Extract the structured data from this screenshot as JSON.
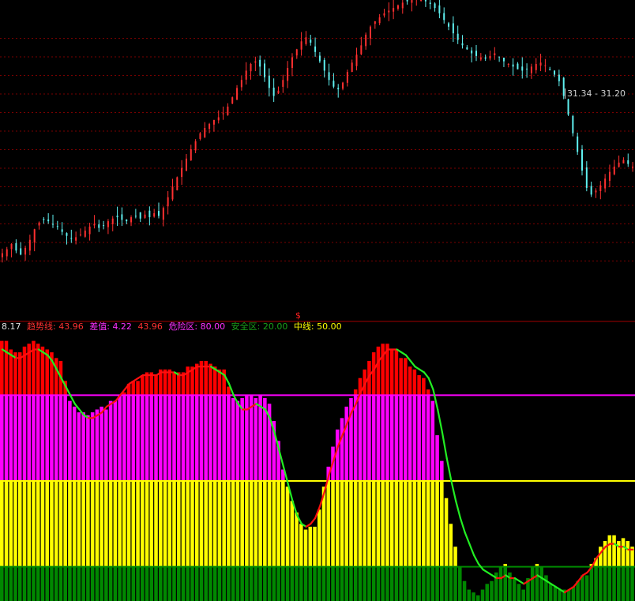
{
  "colors": {
    "background": "#000000",
    "grid": "#7a0000",
    "divider": "#a00000",
    "candle_up": "#ff3030",
    "candle_down": "#5ff0f0",
    "bar_red": "#ff0000",
    "bar_magenta": "#ff00ff",
    "bar_yellow": "#ffff00",
    "bar_green": "#008800",
    "line_green": "#22ee22",
    "line_red": "#ff1010",
    "line_danger": "#ff00ff",
    "line_mid": "#ffff00",
    "line_safe": "#008800"
  },
  "legend": {
    "lead_value": "8.17",
    "trend_label": "趋势线:",
    "trend_value": "43.96",
    "diff_label": "差值:",
    "diff_value": "4.22",
    "trend_value2": "43.96",
    "danger_label": "危险区:",
    "danger_value": "80.00",
    "safe_label": "安全区:",
    "safe_value": "20.00",
    "mid_label": "中线:",
    "mid_value": "50.00"
  },
  "price_tag": "31.34 - 31.20",
  "marker": "$",
  "chart_data": [
    {
      "type": "candlestick",
      "title": "",
      "closes": [
        18.6,
        18.9,
        19.3,
        18.8,
        18.5,
        19.0,
        19.6,
        20.4,
        20.9,
        21.1,
        21.0,
        20.8,
        20.6,
        20.2,
        19.9,
        19.7,
        19.8,
        20.0,
        20.3,
        20.6,
        20.8,
        20.5,
        20.7,
        21.0,
        21.2,
        21.3,
        21.1,
        21.0,
        21.3,
        21.4,
        21.2,
        21.5,
        21.3,
        21.6,
        21.4,
        22.0,
        22.8,
        23.6,
        24.3,
        25.0,
        25.7,
        26.4,
        27.0,
        27.6,
        28.0,
        28.3,
        28.6,
        28.8,
        29.1,
        29.6,
        30.3,
        31.0,
        31.6,
        32.3,
        32.8,
        33.0,
        32.6,
        31.8,
        31.0,
        30.4,
        30.8,
        31.6,
        32.5,
        33.3,
        33.9,
        34.5,
        34.8,
        34.4,
        33.7,
        33.0,
        32.3,
        31.6,
        31.1,
        30.9,
        31.4,
        32.2,
        32.9,
        33.5,
        34.2,
        35.0,
        35.6,
        36.0,
        36.3,
        36.6,
        36.8,
        37.0,
        37.2,
        37.4,
        37.5,
        37.6,
        37.7,
        37.6,
        37.5,
        37.3,
        37.0,
        36.6,
        36.1,
        35.6,
        35.1,
        34.6,
        34.2,
        33.9,
        33.6,
        33.4,
        33.3,
        33.2,
        33.4,
        33.6,
        33.3,
        33.0,
        32.8,
        32.6,
        32.4,
        32.3,
        32.4,
        32.6,
        32.8,
        32.9,
        32.7,
        32.4,
        32.0,
        31.5,
        30.4,
        29.0,
        27.6,
        26.2,
        24.8,
        23.5,
        23.0,
        23.3,
        23.7,
        24.2,
        24.7,
        25.1,
        25.4,
        25.6,
        25.3,
        25.1
      ],
      "price_tag": "31.34 - 31.20",
      "ylim": [
        13.6,
        37.6
      ]
    },
    {
      "type": "bar+line",
      "title": "",
      "series": [
        {
          "name": "趋势线",
          "kind": "line",
          "values": [
            96,
            95,
            94,
            93,
            93,
            94,
            95,
            96,
            96,
            95,
            94,
            92,
            89,
            86,
            83,
            80,
            77,
            75,
            73,
            72,
            72,
            73,
            74,
            76,
            77,
            78,
            80,
            82,
            84,
            85,
            86,
            87,
            87,
            87,
            87,
            88,
            88,
            88,
            88,
            87,
            87,
            88,
            89,
            90,
            90,
            90,
            90,
            89,
            88,
            87,
            84,
            80,
            77,
            75,
            75,
            76,
            77,
            76,
            75,
            72,
            67,
            61,
            55,
            49,
            43,
            38,
            35,
            34,
            35,
            37,
            41,
            46,
            52,
            57,
            62,
            66,
            70,
            74,
            77,
            81,
            84,
            87,
            89,
            92,
            94,
            96,
            96,
            96,
            95,
            94,
            92,
            90,
            89,
            88,
            86,
            82,
            75,
            67,
            58,
            50,
            43,
            37,
            32,
            28,
            24,
            21,
            19,
            18,
            17,
            16,
            16,
            17,
            16,
            16,
            15,
            14,
            15,
            16,
            17,
            16,
            15,
            14,
            13,
            12,
            11,
            12,
            13,
            15,
            17,
            18,
            20,
            23,
            25,
            27,
            28,
            28,
            27,
            27,
            26,
            26
          ],
          "split_index": 62
        },
        {
          "name": "差值",
          "kind": "bar",
          "values": [
            99,
            99,
            96,
            95,
            95,
            97,
            98,
            99,
            98,
            97,
            96,
            95,
            93,
            92,
            85,
            78,
            76,
            74,
            74,
            73,
            74,
            75,
            76,
            75,
            78,
            78,
            80,
            81,
            84,
            85,
            85,
            87,
            88,
            88,
            87,
            89,
            89,
            89,
            88,
            88,
            88,
            90,
            90,
            91,
            92,
            92,
            91,
            90,
            89,
            89,
            83,
            79,
            78,
            79,
            80,
            80,
            79,
            80,
            79,
            77,
            71,
            64,
            54,
            48,
            43,
            39,
            35,
            33,
            34,
            34,
            40,
            48,
            55,
            62,
            68,
            72,
            76,
            79,
            82,
            86,
            89,
            92,
            95,
            97,
            98,
            98,
            96,
            96,
            93,
            93,
            90,
            89,
            87,
            86,
            82,
            78,
            66,
            57,
            44,
            35,
            27,
            20,
            15,
            12,
            11,
            10,
            12,
            14,
            15,
            18,
            20,
            21,
            18,
            16,
            14,
            12,
            16,
            20,
            21,
            20,
            17,
            14,
            13,
            12,
            12,
            12,
            13,
            15,
            17,
            17,
            21,
            23,
            27,
            29,
            31,
            31,
            29,
            30,
            29,
            27
          ]
        }
      ],
      "reference_lines": [
        {
          "name": "危险区",
          "value": 80
        },
        {
          "name": "中线",
          "value": 50
        },
        {
          "name": "安全区",
          "value": 20
        }
      ],
      "ylim": [
        0,
        100
      ]
    }
  ]
}
